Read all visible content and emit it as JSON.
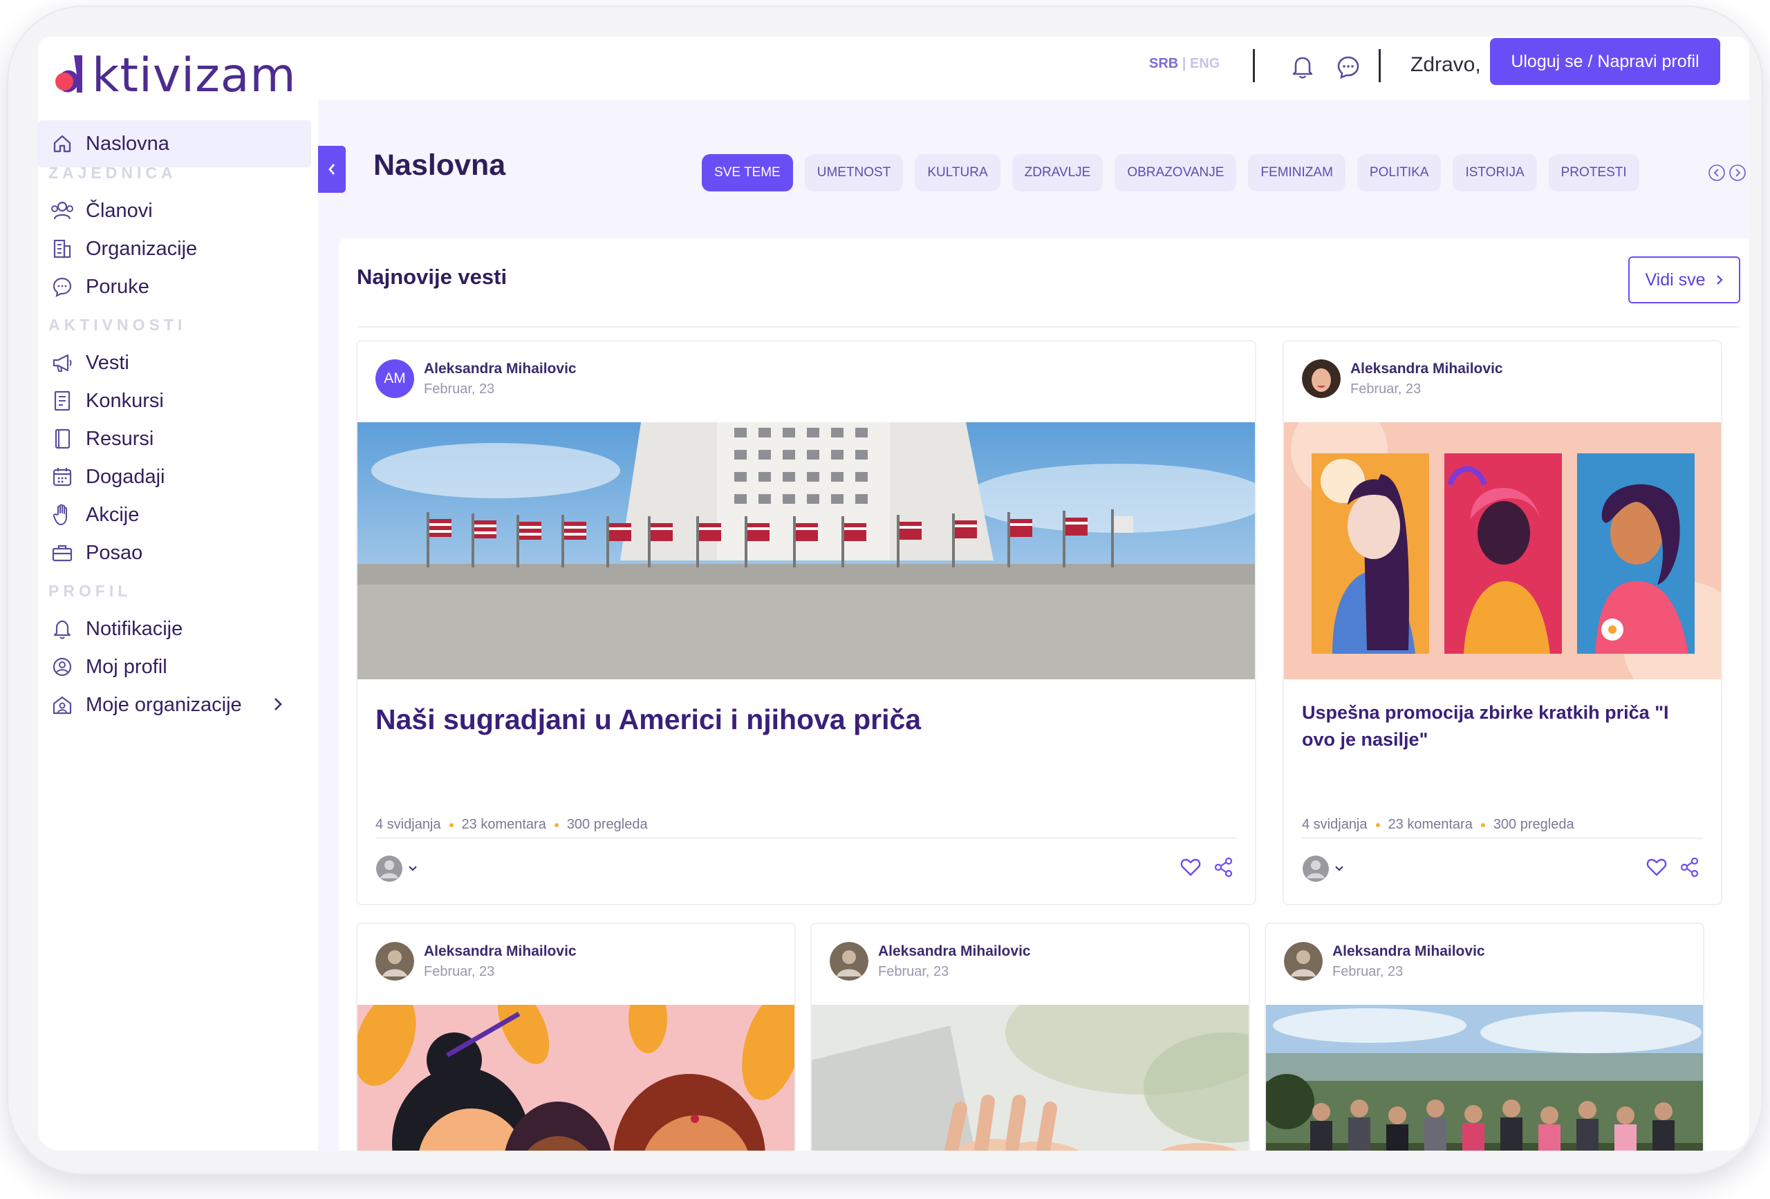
{
  "app": {
    "logo_text": "ktivizam"
  },
  "topbar": {
    "lang_srb": "SRB",
    "lang_sep": " | ",
    "lang_eng": "ENG",
    "greeting": "Zdravo,",
    "login_label": "Uloguj se / Napravi profil"
  },
  "sidebar": {
    "home": "Naslovna",
    "section_community": "ZAJEDNICA",
    "members": "Članovi",
    "organizations": "Organizacije",
    "messages": "Poruke",
    "section_activities": "AKTIVNOSTI",
    "news": "Vesti",
    "contests": "Konkursi",
    "resources": "Resursi",
    "events": "Dogadaji",
    "actions": "Akcije",
    "jobs": "Posao",
    "section_profile": "PROFIL",
    "notifications": "Notifikacije",
    "my_profile": "Moj profil",
    "my_organizations": "Moje organizacije"
  },
  "main": {
    "page_title": "Naslovna",
    "chips": [
      "SVE TEME",
      "UMETNOST",
      "KULTURA",
      "ZDRAVLJE",
      "OBRAZOVANJE",
      "FEMINIZAM",
      "POLITIKA",
      "ISTORIJA",
      "PROTESTI"
    ],
    "section_title": "Najnovije vesti",
    "see_all": "Vidi sve"
  },
  "cards": [
    {
      "author": "Aleksandra Mihailovic",
      "date": "Februar, 23",
      "avatar_initials": "AM",
      "title": "Naši sugradjani u Americi i njihova priča",
      "likes": "4 svidjanja",
      "comments": "23 komentara",
      "views": "300 pregleda"
    },
    {
      "author": "Aleksandra Mihailovic",
      "date": "Februar, 23",
      "title": "Uspešna promocija zbirke kratkih priča \"I ovo je nasilje\"",
      "likes": "4 svidjanja",
      "comments": "23 komentara",
      "views": "300 pregleda"
    },
    {
      "author": "Aleksandra Mihailovic",
      "date": "Februar, 23"
    },
    {
      "author": "Aleksandra Mihailovic",
      "date": "Februar, 23"
    },
    {
      "author": "Aleksandra Mihailovic",
      "date": "Februar, 23"
    }
  ],
  "colors": {
    "accent": "#6a4ef5",
    "title": "#3a1f7a",
    "stat_dot": "#f4b135"
  }
}
